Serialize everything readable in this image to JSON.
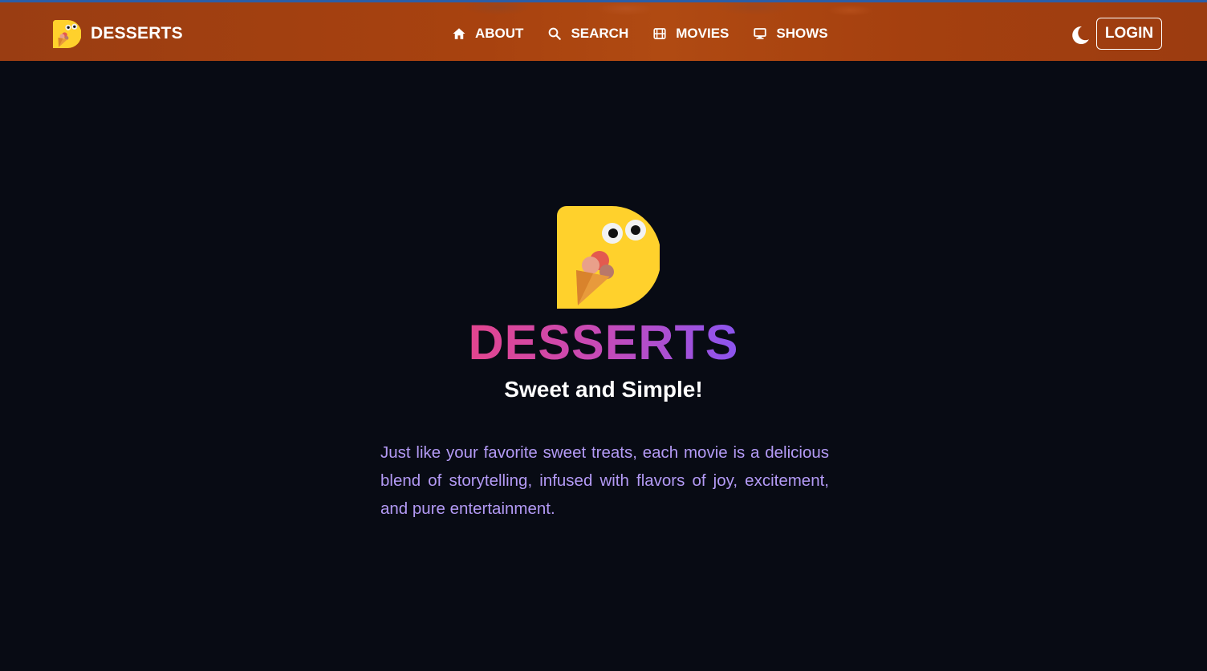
{
  "nav": {
    "brand": "DESSERTS",
    "links": [
      {
        "label": "ABOUT",
        "icon": "home-icon"
      },
      {
        "label": "SEARCH",
        "icon": "search-icon"
      },
      {
        "label": "MOVIES",
        "icon": "film-icon"
      },
      {
        "label": "SHOWS",
        "icon": "tv-icon"
      }
    ],
    "theme_toggle_icon": "moon-icon",
    "login_label": "LOGIN"
  },
  "hero": {
    "title": "DESSERTS",
    "subtitle": "Sweet and Simple!",
    "description": "Just like your favorite sweet treats, each movie is a delicious blend of storytelling, infused with flavors of joy, excitement, and pure entertainment."
  },
  "colors": {
    "navbar": "#a3410f",
    "background": "#080b14",
    "title_gradient_start": "#e2458e",
    "title_gradient_end": "#8b55f0",
    "description_text": "#b39af5",
    "logo_yellow": "#ffd12c"
  }
}
